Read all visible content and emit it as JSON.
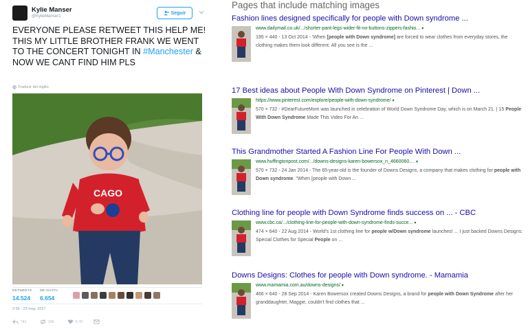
{
  "tweet": {
    "user_name": "Kylie Manser",
    "user_handle": "@KylieManser1",
    "follow_label": "Seguir",
    "text_main": "EVERYONE PLEASE RETWEET THIS HELP ME!\nTHIS MY LITTLE BROTHER FRANK WE WENT TO THE CONCERT TONIGHT IN ",
    "hashtag": "#Manchester",
    "text_end": " & NOW WE CANT FIND HIM PLS",
    "translate_label": "Traducir del inglés",
    "retweets_label": "RETWEETS",
    "retweets_value": "14.524",
    "likes_label": "ME GUSTA",
    "likes_value": "6.654",
    "timestamp": "2:55 - 23 may. 2017",
    "actions": {
      "reply_count": "741",
      "retweet_count": "15K",
      "like_count": "6,7K"
    },
    "icons": [
      "follow-person-icon",
      "caret-down-icon",
      "globe-icon",
      "reply-icon",
      "retweet-icon",
      "heart-icon",
      "direct-message-icon"
    ]
  },
  "results": {
    "heading": "Pages that include matching images",
    "items": [
      {
        "title": "Fashion lines designed specifically for people with Down syndrome ...",
        "url": "www.dailymail.co.uk/.../shorter-pant-legs-wider-fit-no-buttons-zippers-fashio...",
        "snippet_html": "195 × 440 - 13 Oct 2014 - 'When <b>[people with Down syndrome]</b> are forced to wear clothes from everyday stores, the clothing makes them look different. All you see is the ..."
      },
      {
        "title": "17 Best ideas about People With Down Syndrome on Pinterest | Down ...",
        "url": "https://www.pinterest.com/explore/people-with-down-syndrome/",
        "snippet_html": "570 × 732 - #DearFutureMom was launched in celebration of World Down Syndrome Day, which is on March 21. | 15 <b>People With Down Syndrome</b> Made This Video For An ..."
      },
      {
        "title": "This Grandmother Started A Fashion Line For People With Down ...",
        "url": "www.huffingtonpost.com/.../downs-designs-karen-bowersox_n_4660060....",
        "snippet_html": "570 × 732 - 24 Jan 2014 - The 65-year-old is the founder of Downs Designs, a company that makes clothing for <b>people with Down syndrome</b>. \"When [people with Down ..."
      },
      {
        "title": "Clothing line for people with Down Syndrome finds success on ... - CBC",
        "url": "www.cbc.ca/.../clothing-line-for-people-with-down-syndrome-finds-succe...",
        "snippet_html": "474 × 640 - 22 Aug 2014 - World's 1st clothing line for <b>people w/Down syndrome</b> launches! ... I just backed Downs Designs: Special Clothes for Special <b>People</b> on ..."
      },
      {
        "title": "Downs Designs: Clothes for people with Down syndrome. - Mamamia",
        "url": "www.mamamia.com.au/downs-designs/",
        "snippet_html": "466 × 640 - 28 Sep 2014 - Karen Bowersox created Downs Designs, a brand for <b>people with Down Syndrome</b> after her granddaughter, Maggie, couldn't find clothes that ..."
      }
    ]
  },
  "colors": {
    "accent": "#1da1f2",
    "link": "#1a0dab",
    "url": "#006621",
    "snippet": "#545454"
  }
}
